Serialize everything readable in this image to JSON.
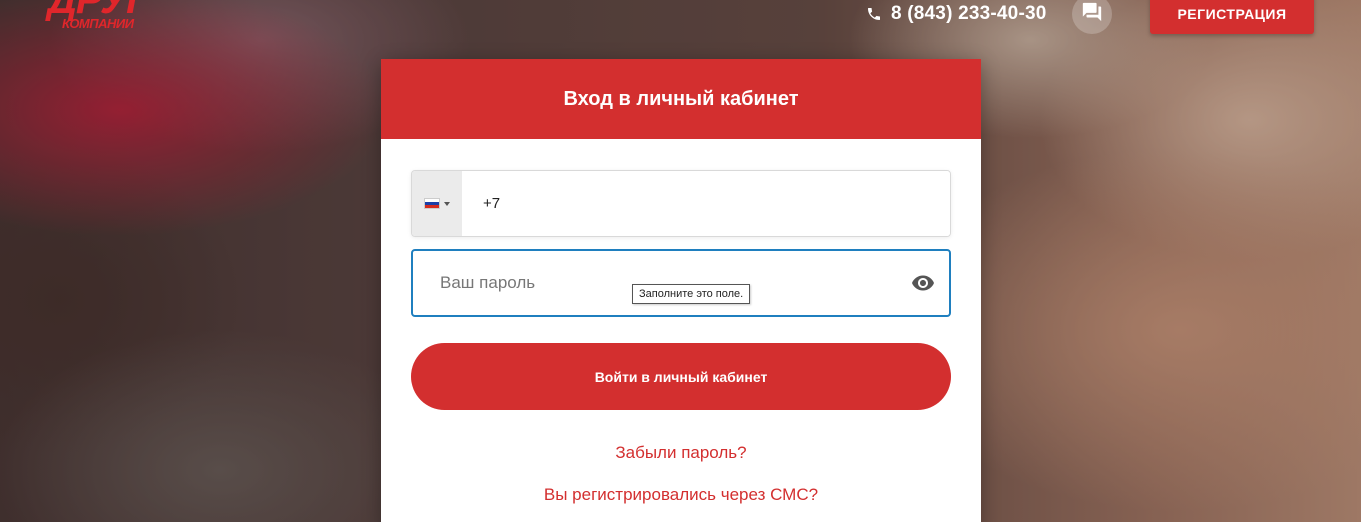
{
  "header": {
    "logo_main": "ДРУГ",
    "logo_sub": "КОМПАНИИ",
    "phone": "8 (843) 233-40-30",
    "register_label": "РЕГИСТРАЦИЯ"
  },
  "login": {
    "title": "Вход в личный кабинет",
    "phone_value": "+7",
    "country_flag": "ru-flag-icon",
    "password_placeholder": "Ваш пароль",
    "tooltip": "Заполните это поле.",
    "submit_label": "Войти в личный кабинет",
    "forgot_label": "Забыли пароль?",
    "sms_label": "Вы регистрировались через СМС?"
  },
  "colors": {
    "accent": "#d32f2f",
    "focus_border": "#1f7fbf"
  }
}
